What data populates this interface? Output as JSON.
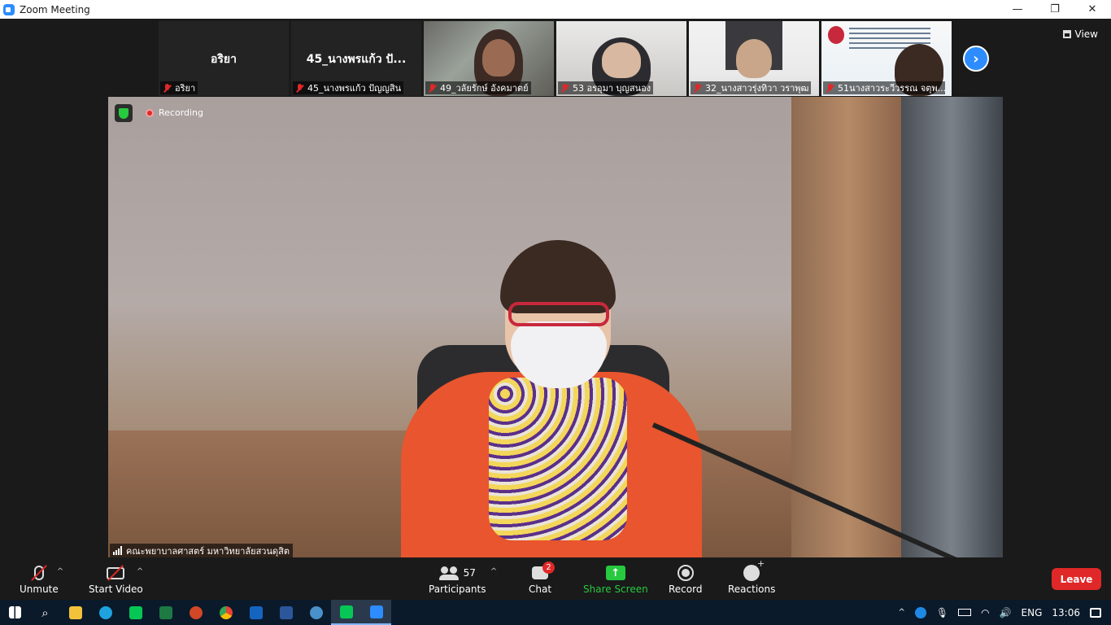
{
  "window": {
    "title": "Zoom Meeting",
    "minimize": "—",
    "restore": "❐",
    "close": "✕"
  },
  "strip": {
    "tiles": [
      {
        "big_name": "อริยา",
        "label": "อริยา"
      },
      {
        "big_name": "45_นางพรแก้ว ปั...",
        "label": "45_นางพรแก้ว ปัญญสิน"
      },
      {
        "big_name": "",
        "label": "49_วลัยรักษ์  อังคมาตย์"
      },
      {
        "big_name": "",
        "label": "53 อรอุมา  บุญสนอง"
      },
      {
        "big_name": "",
        "label": "32_นางสาวรุ่งทิวา  วราพุฒ"
      },
      {
        "big_name": "",
        "label": "51นางสาวระวีวรรณ จตุพ..."
      }
    ],
    "next_icon": "chevron-right-icon",
    "view_label": "View"
  },
  "main": {
    "recording_label": "Recording",
    "speaker_label": "คณะพยาบาลศาสตร์ มหาวิทยาลัยสวนดุสิต"
  },
  "toolbar": {
    "unmute_label": "Unmute",
    "start_video_label": "Start Video",
    "participants_label": "Participants",
    "participants_count": "57",
    "chat_label": "Chat",
    "chat_badge": "2",
    "share_label": "Share Screen",
    "record_label": "Record",
    "reactions_label": "Reactions",
    "leave_label": "Leave",
    "caret": "^"
  },
  "taskbar": {
    "tray_caret": "^",
    "language": "ENG",
    "time": "13:06"
  },
  "colors": {
    "accent": "#2d8cff",
    "leave": "#e02828",
    "share": "#27c93f"
  }
}
